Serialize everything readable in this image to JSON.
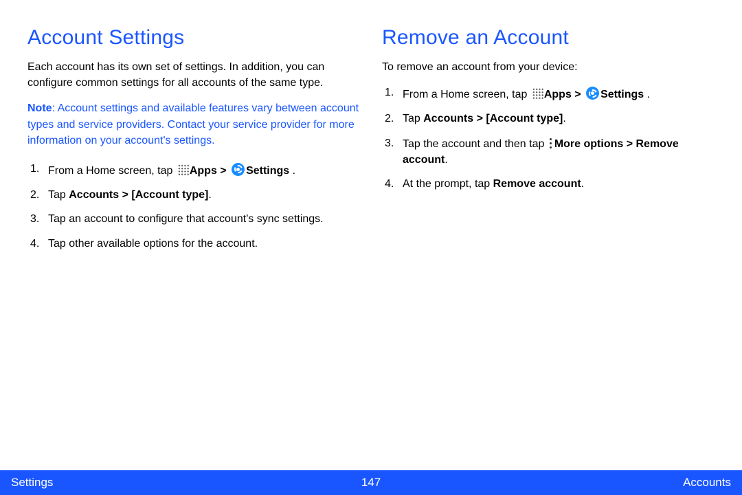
{
  "left": {
    "title": "Account Settings",
    "intro": "Each account has its own set of settings. In addition, you can configure common settings for all accounts of the same type.",
    "note_label": "Note",
    "note_body": ": Account settings and available features vary between account types and service providers. Contact your service provider for more information on your account's settings.",
    "step1_a": "From a Home screen, tap ",
    "step1_apps": "Apps",
    "step1_gt": " > ",
    "step1_settings": "Settings",
    "step1_end": " .",
    "step2_a": "Tap ",
    "step2_b": "Accounts > [Account type]",
    "step2_c": ".",
    "step3": "Tap an account to configure that account's sync settings.",
    "step4": "Tap other available options for the account."
  },
  "right": {
    "title": "Remove an Account",
    "intro": "To remove an account from your device:",
    "step1_a": "From a Home screen, tap ",
    "step1_apps": "Apps",
    "step1_gt": " > ",
    "step1_settings": "Settings",
    "step1_end": " .",
    "step2_a": "Tap ",
    "step2_b": "Accounts > [Account type]",
    "step2_c": ".",
    "step3_a": "Tap the account and then tap ",
    "step3_b": "More options > Remove account",
    "step3_c": ".",
    "step4_a": "At the prompt, tap ",
    "step4_b": "Remove account",
    "step4_c": "."
  },
  "footer": {
    "left": "Settings",
    "center": "147",
    "right": "Accounts"
  }
}
